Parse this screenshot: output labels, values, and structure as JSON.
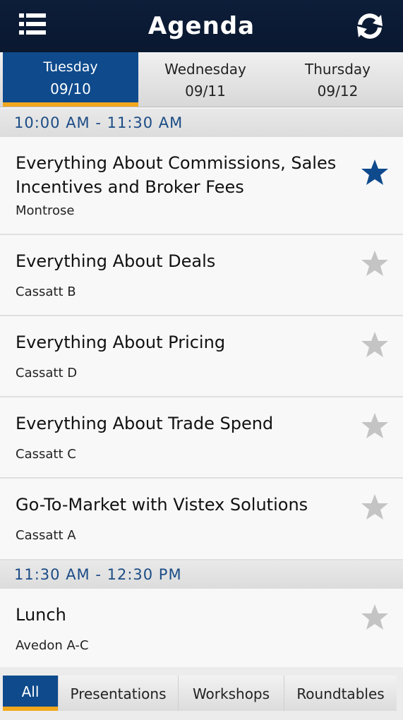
{
  "header": {
    "title": "Agenda",
    "menu_icon": "hamburger-menu-icon",
    "refresh_icon": "refresh-icon"
  },
  "days": [
    {
      "name": "Tuesday",
      "date": "09/10",
      "active": true
    },
    {
      "name": "Wednesday",
      "date": "09/11",
      "active": false
    },
    {
      "name": "Thursday",
      "date": "09/12",
      "active": false
    }
  ],
  "blocks": [
    {
      "time": "10:00 AM - 11:30 AM",
      "sessions": [
        {
          "title": "Everything About Commissions, Sales Incentives and Broker Fees",
          "room": "Montrose",
          "favorite": true
        },
        {
          "title": "Everything About Deals",
          "room": "Cassatt B",
          "favorite": false
        },
        {
          "title": "Everything About Pricing",
          "room": "Cassatt D",
          "favorite": false
        },
        {
          "title": "Everything About Trade Spend",
          "room": "Cassatt C",
          "favorite": false
        },
        {
          "title": "Go-To-Market with Vistex Solutions",
          "room": "Cassatt A",
          "favorite": false
        }
      ]
    },
    {
      "time": "11:30 AM - 12:30 PM",
      "sessions": [
        {
          "title": "Lunch",
          "room": "Avedon A-C",
          "favorite": false
        }
      ]
    }
  ],
  "filters": [
    {
      "label": "All",
      "active": true
    },
    {
      "label": "Presentations",
      "active": false
    },
    {
      "label": "Workshops",
      "active": false
    },
    {
      "label": "Roundtables",
      "active": false
    }
  ],
  "colors": {
    "accent": "#0e4a8c",
    "indicator": "#f2a81d",
    "star_active": "#0e4a8c",
    "star_inactive": "#c4c4c4"
  }
}
